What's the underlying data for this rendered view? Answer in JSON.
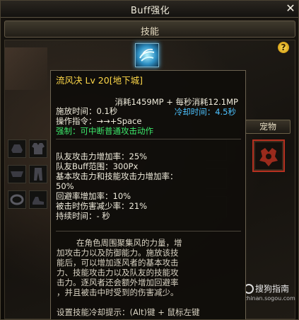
{
  "window": {
    "title": "Buff强化",
    "close_label": "✕",
    "section_label": "技能"
  },
  "pet_tab_label": "宠物",
  "watermark": {
    "text": "搜狗指南",
    "url": "zhinan.sogou.com"
  },
  "tooltip": {
    "title": "流风决 Lv 20[地下城]",
    "cost": "消耗1459MP + 每秒消耗12.1MP",
    "cast_time": "施放时间：0.1秒",
    "cooldown": "冷却时间：4.5秒",
    "command": "操作指令：→→+Space",
    "constraint": "强制：可中断普通攻击动作",
    "stats": [
      "队友攻击力增加率：25%",
      "队友Buff范围：300Px",
      "基本攻击力和技能攻击力增加率：",
      "50%",
      "回避率增加率：10%",
      "被击时伤害减少率：21%",
      "持续时间：- 秒"
    ],
    "description": [
      "在角色周围聚集风的力量，增",
      "加攻击力以及防御能力。施放该技",
      "能后，可以增加逐风者的基本攻击",
      "力、技能攻击力以及队友的技能攻",
      "击力。逐风者还会额外增加回避率",
      "，并且被击中时受到的伤害减少。"
    ],
    "hint": "设置技能冷却提示：(Alt)键 + 鼠标左键"
  },
  "colors": {
    "title_yellow": "#ffd94a",
    "cooldown_blue": "#4cc2ff",
    "constraint_green": "#3ce86a",
    "pet_slot_border": "#b63020"
  }
}
